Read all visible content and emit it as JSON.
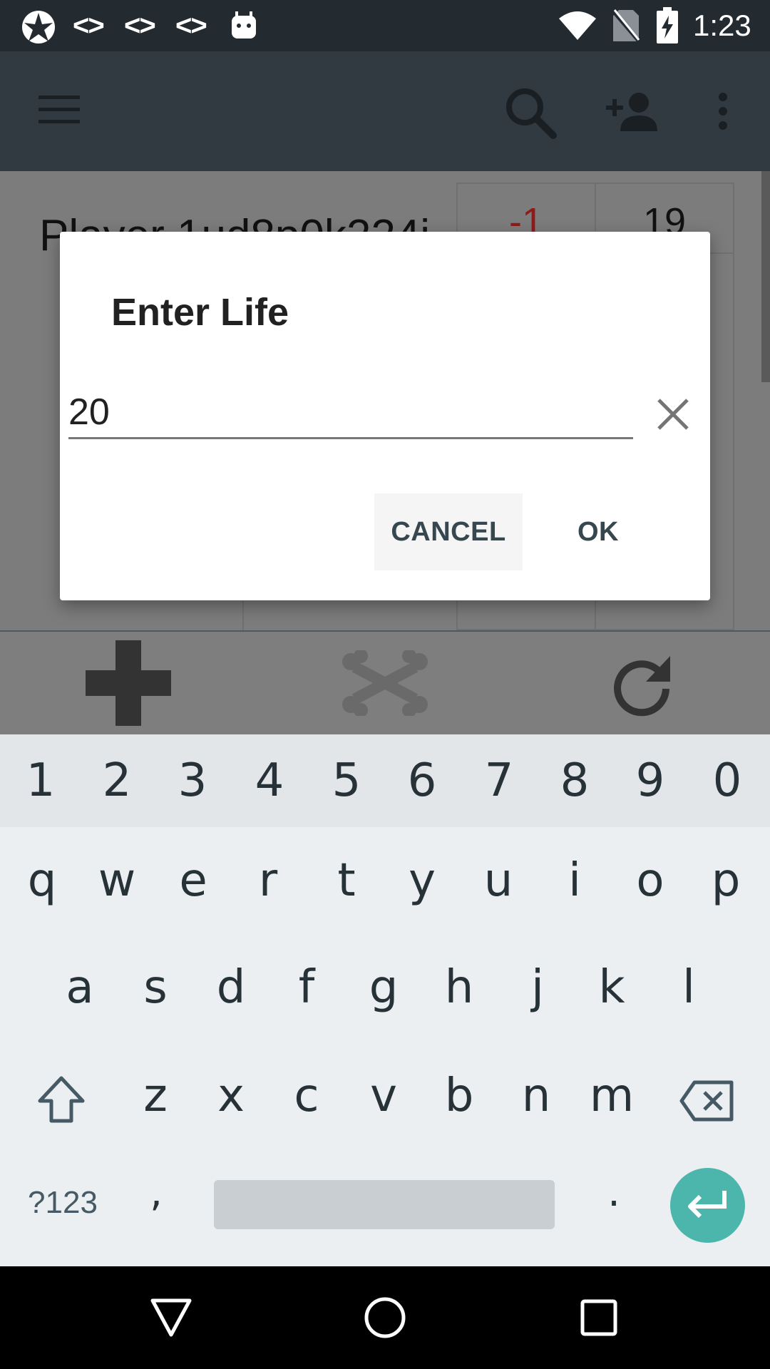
{
  "status_bar": {
    "time": "1:23",
    "notification_codes": [
      "<>",
      "<>",
      "<>"
    ]
  },
  "background_content": {
    "player_name": "Player 1ud8p0k224i",
    "minus_value": "-1",
    "life_value": "19"
  },
  "dialog": {
    "title": "Enter Life",
    "input_value": "20",
    "cancel_label": "CANCEL",
    "ok_label": "OK"
  },
  "keyboard": {
    "number_row": [
      "1",
      "2",
      "3",
      "4",
      "5",
      "6",
      "7",
      "8",
      "9",
      "0"
    ],
    "row1": [
      "q",
      "w",
      "e",
      "r",
      "t",
      "y",
      "u",
      "i",
      "o",
      "p"
    ],
    "row2": [
      "a",
      "s",
      "d",
      "f",
      "g",
      "h",
      "j",
      "k",
      "l"
    ],
    "row3": [
      "z",
      "x",
      "c",
      "v",
      "b",
      "n",
      "m"
    ],
    "symbols_label": "?123",
    "comma": ",",
    "period": "."
  },
  "colors": {
    "status_bar": "#232a30",
    "toolbar": "#323a41",
    "accent_enter": "#4db6ac",
    "minus_text": "#8e1b1b"
  }
}
